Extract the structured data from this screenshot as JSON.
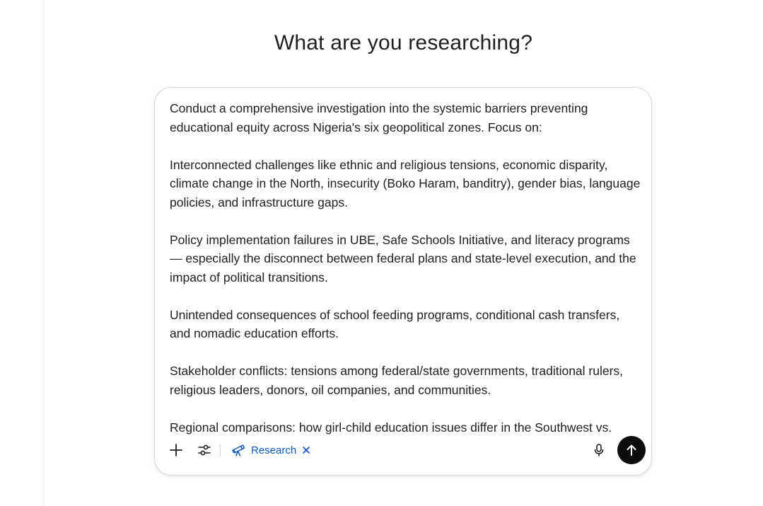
{
  "heading": "What are you researching?",
  "prompt": {
    "paragraphs": [
      "Conduct a comprehensive investigation into the systemic barriers preventing educational equity across Nigeria's six geopolitical zones. Focus on:",
      "Interconnected challenges like ethnic and religious tensions, economic disparity, climate change in the North, insecurity (Boko Haram, banditry), gender bias, language policies, and infrastructure gaps.",
      "Policy implementation failures in UBE, Safe Schools Initiative, and literacy programs — especially the disconnect between federal plans and state-level execution, and the impact of political transitions.",
      "Unintended consequences of school feeding programs, conditional cash transfers, and nomadic education efforts.",
      "Stakeholder conflicts: tensions among federal/state governments, traditional rulers, religious leaders, donors, oil companies, and communities.",
      "Regional comparisons: how girl-child education issues differ in the Southwest vs."
    ]
  },
  "toolbar": {
    "add_icon": "plus-icon",
    "tools_icon": "sliders-icon",
    "research_label": "Research",
    "research_icon": "telescope-icon",
    "research_close_icon": "close-icon",
    "mic_icon": "microphone-icon",
    "send_icon": "arrow-up-icon"
  },
  "colors": {
    "accent": "#0b57d0",
    "send_button": "#0d0d0d",
    "text": "#1f1f1f",
    "border": "#d6d6d6"
  }
}
